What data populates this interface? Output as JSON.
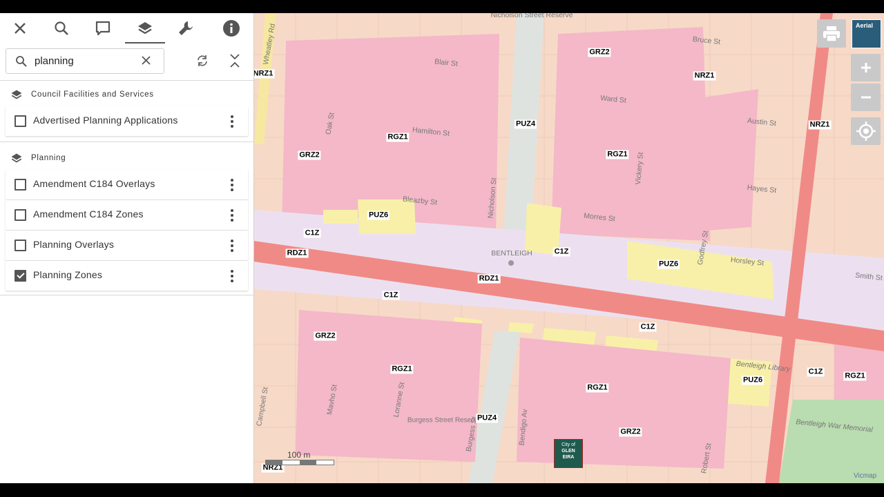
{
  "toolbar": {
    "tools": [
      {
        "name": "close-icon"
      },
      {
        "name": "search-icon"
      },
      {
        "name": "comment-icon"
      },
      {
        "name": "layers-icon",
        "active": true
      },
      {
        "name": "wrench-icon"
      },
      {
        "name": "info-icon"
      }
    ]
  },
  "search": {
    "value": "planning"
  },
  "groups": [
    {
      "title": "Council Facilities and Services",
      "items": [
        {
          "label": "Advertised Planning Applications",
          "checked": false
        }
      ]
    },
    {
      "title": "Planning",
      "items": [
        {
          "label": "Amendment C184 Overlays",
          "checked": false
        },
        {
          "label": "Amendment C184 Zones",
          "checked": false
        },
        {
          "label": "Planning Overlays",
          "checked": false
        },
        {
          "label": "Planning Zones",
          "checked": true
        }
      ]
    }
  ],
  "map": {
    "aerial_label": "Aerial",
    "scale_label": "100 m",
    "logo_lines": [
      "City of",
      "GLEN",
      "EIRA"
    ],
    "attribution": "Vicmap",
    "streets": [
      "Nicholson Street Reserve",
      "Bruce St",
      "Blair St",
      "Wheatley Rd",
      "Ward St",
      "Hamilton St",
      "Austin St",
      "Oak St",
      "Nicholson St",
      "Vickery St",
      "Hayes St",
      "Bleazby St",
      "Morres St",
      "Godfrey St",
      "BENTLEIGH",
      "Horsley St",
      "Smith St",
      "Bentleigh Library",
      "Campbell St",
      "Mavho St",
      "Loranne St",
      "Burgess St",
      "Burgess Street Reserve",
      "Bendigo Av",
      "Robert St",
      "Bentleigh War Memorial"
    ],
    "zones": [
      "GRZ2",
      "NRZ1",
      "NRZ1",
      "NRZ1",
      "PUZ4",
      "RGZ1",
      "GRZ2",
      "RGZ1",
      "PUZ6",
      "C1Z",
      "RDZ1",
      "C1Z",
      "PUZ6",
      "RDZ1",
      "C1Z",
      "C1Z",
      "GRZ2",
      "RGZ1",
      "RGZ1",
      "PUZ6",
      "C1Z",
      "RGZ1",
      "PUZ4",
      "GRZ2",
      "NRZ1"
    ]
  },
  "colors": {
    "residential_pink": "#f4b8c8",
    "general_residential": "#f7d9c8",
    "commercial": "#ece0f0",
    "public_use": "#f8f0a8",
    "road_zone": "#f08a86",
    "park": "#b9dcb0",
    "accent": "#555555"
  }
}
